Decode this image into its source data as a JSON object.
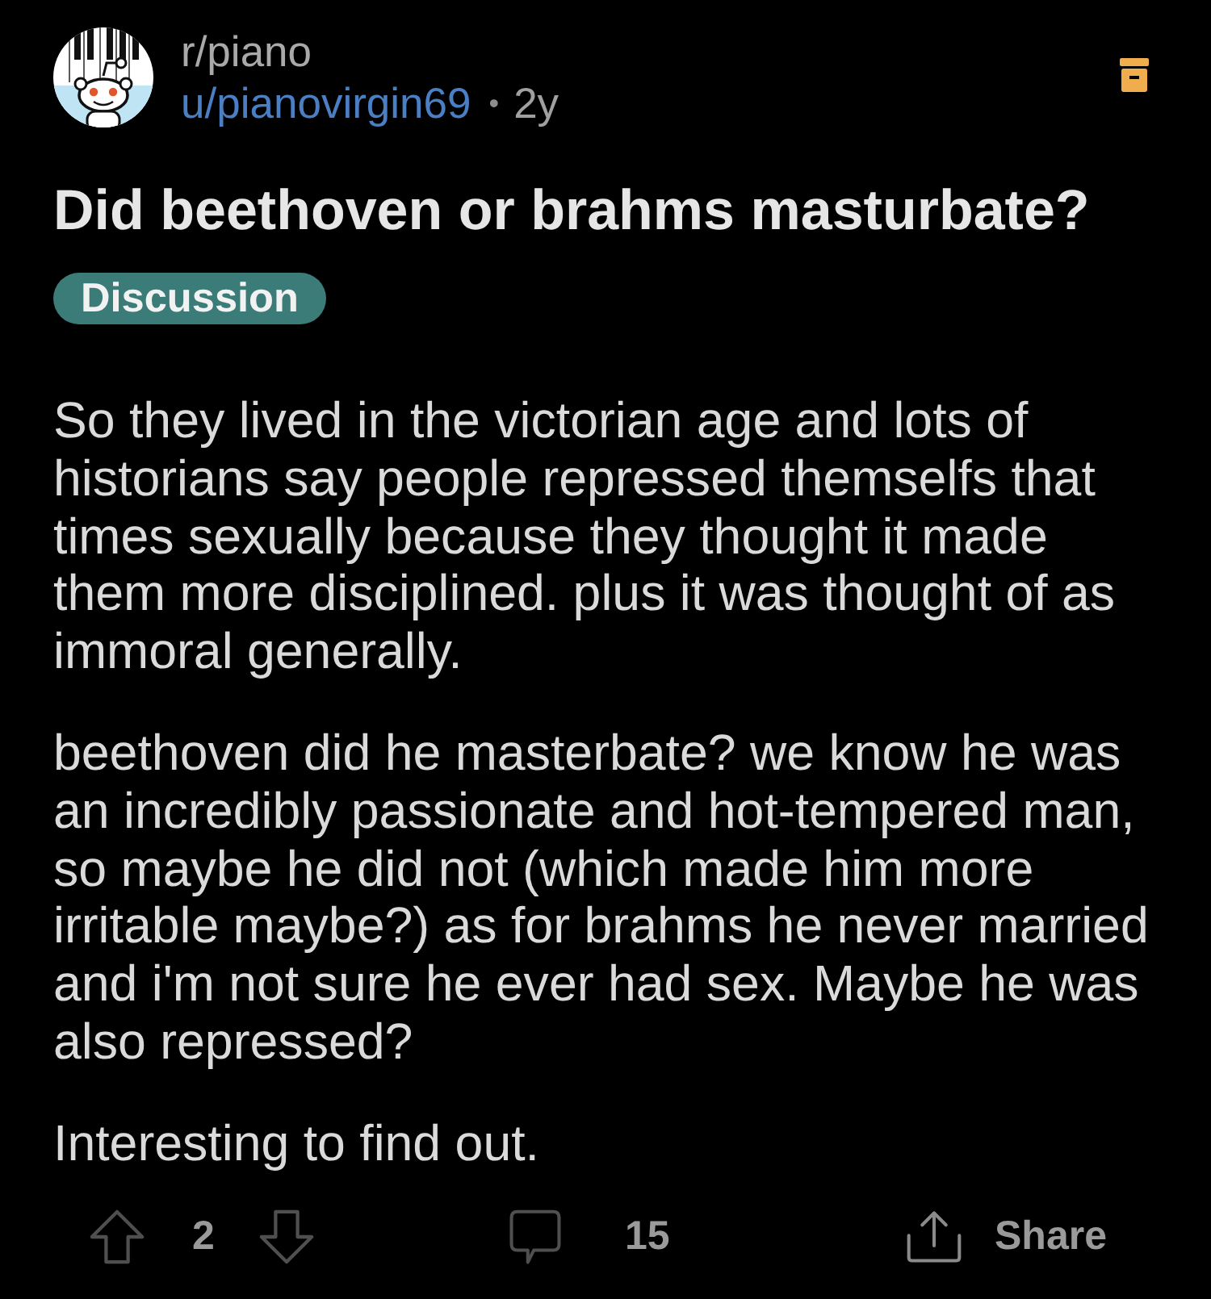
{
  "post": {
    "subreddit": "r/piano",
    "author": "u/pianovirgin69",
    "separator": "•",
    "age": "2y",
    "title": "Did beethoven or brahms masturbate?",
    "flair": "Discussion",
    "body": [
      "So they lived in the victorian age and lots of historians say people repressed themselfs that times sexually because they thought it made them more disciplined. plus it was thought of as immoral generally.",
      "beethoven did he masterbate? we know he was an incredibly passionate and hot-tempered man, so maybe he did not (which made him more irritable maybe?) as for brahms he never married and i'm not sure he ever had sex. Maybe he was also repressed?",
      "Interesting to find out."
    ]
  },
  "actions": {
    "score": "2",
    "comments": "15",
    "share": "Share"
  }
}
